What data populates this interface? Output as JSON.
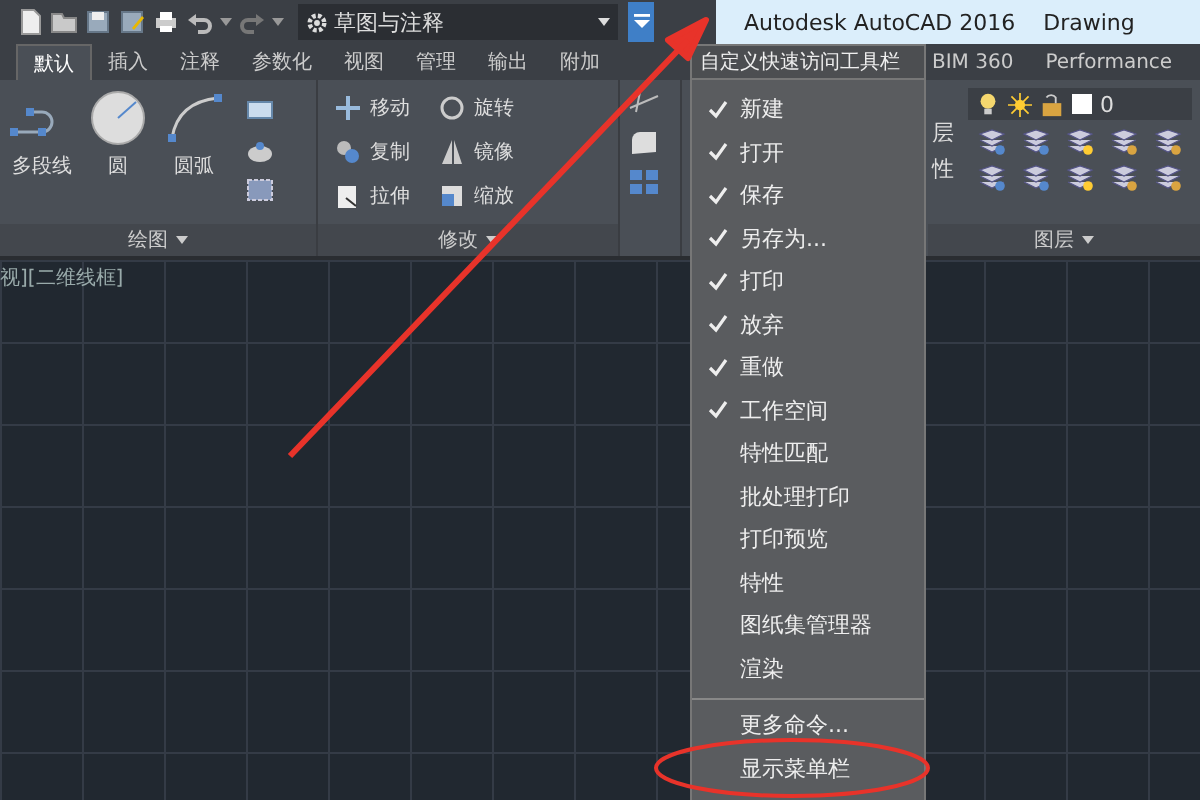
{
  "quick_access": {
    "workspace": "草图与注释"
  },
  "title_bar": {
    "app": "Autodesk AutoCAD 2016",
    "document": "Drawing"
  },
  "tabs": [
    {
      "label": "默认",
      "selected": true
    },
    {
      "label": "插入",
      "selected": false
    },
    {
      "label": "注释",
      "selected": false
    },
    {
      "label": "参数化",
      "selected": false
    },
    {
      "label": "视图",
      "selected": false
    },
    {
      "label": "管理",
      "selected": false
    },
    {
      "label": "输出",
      "selected": false
    },
    {
      "label": "附加",
      "selected": false
    },
    {
      "label": "BIM 360",
      "selected": false
    },
    {
      "label": "Performance",
      "selected": false
    }
  ],
  "draw_panel": {
    "label": "绘图",
    "tools": [
      "多段线",
      "圆",
      "圆弧"
    ]
  },
  "modify_panel": {
    "label": "修改",
    "tools": [
      "移动",
      "旋转",
      "复制",
      "镜像",
      "拉伸",
      "缩放"
    ]
  },
  "layers_panel": {
    "label": "图层",
    "current_layer": "0",
    "properties_label_parts": [
      "层",
      "性"
    ]
  },
  "canvas": {
    "viewport_label": "视][二维线框]"
  },
  "menu": {
    "title": "自定义快速访问工具栏",
    "items": [
      {
        "label": "新建",
        "checked": true
      },
      {
        "label": "打开",
        "checked": true
      },
      {
        "label": "保存",
        "checked": true
      },
      {
        "label": "另存为...",
        "checked": true
      },
      {
        "label": "打印",
        "checked": true
      },
      {
        "label": "放弃",
        "checked": true
      },
      {
        "label": "重做",
        "checked": true
      },
      {
        "label": "工作空间",
        "checked": true
      },
      {
        "label": "特性匹配",
        "checked": false
      },
      {
        "label": "批处理打印",
        "checked": false
      },
      {
        "label": "打印预览",
        "checked": false
      },
      {
        "label": "特性",
        "checked": false
      },
      {
        "label": "图纸集管理器",
        "checked": false
      },
      {
        "label": "渲染",
        "checked": false
      }
    ],
    "more_items": [
      "更多命令...",
      "显示菜单栏"
    ]
  }
}
